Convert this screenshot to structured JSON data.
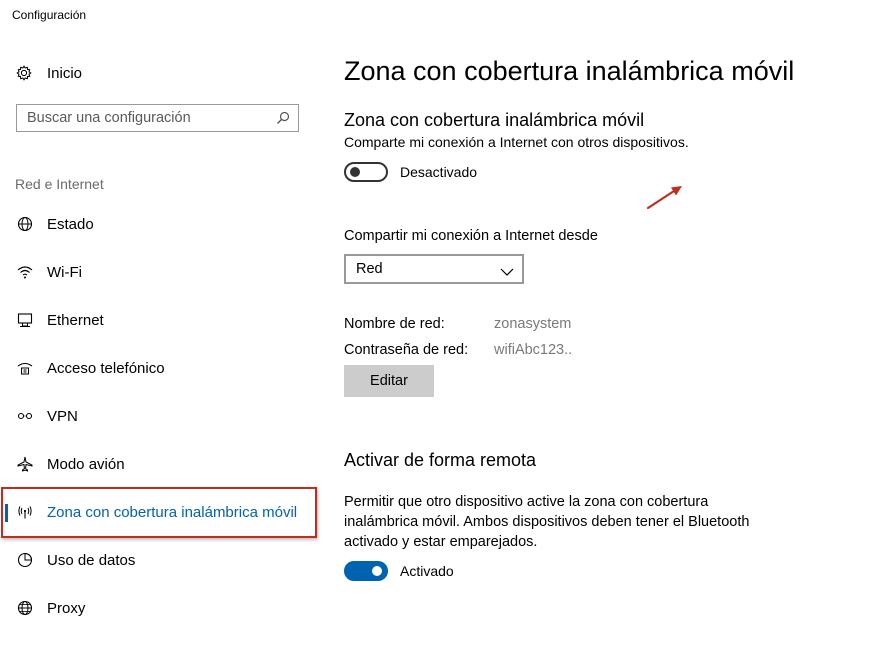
{
  "window": {
    "title": "Configuración"
  },
  "sidebar": {
    "home_label": "Inicio",
    "search_placeholder": "Buscar una configuración",
    "section_label": "Red e Internet",
    "items": [
      {
        "label": "Estado",
        "icon": "globe-network-icon"
      },
      {
        "label": "Wi-Fi",
        "icon": "wifi-icon"
      },
      {
        "label": "Ethernet",
        "icon": "ethernet-icon"
      },
      {
        "label": "Acceso telefónico",
        "icon": "dialup-icon"
      },
      {
        "label": "VPN",
        "icon": "vpn-icon"
      },
      {
        "label": "Modo avión",
        "icon": "airplane-icon"
      },
      {
        "label": "Zona con cobertura inalámbrica móvil",
        "icon": "hotspot-icon",
        "active": true
      },
      {
        "label": "Uso de datos",
        "icon": "data-usage-icon"
      },
      {
        "label": "Proxy",
        "icon": "globe-icon"
      }
    ]
  },
  "main": {
    "title": "Zona con cobertura inalámbrica móvil",
    "hotspot": {
      "heading": "Zona con cobertura inalámbrica móvil",
      "description": "Comparte mi conexión a Internet con otros dispositivos.",
      "toggle_state": "off",
      "toggle_label": "Desactivado"
    },
    "share_from": {
      "label": "Compartir mi conexión a Internet desde",
      "selected": "Red"
    },
    "network": {
      "name_label": "Nombre de red:",
      "name_value": "zonasystem",
      "password_label": "Contraseña de red:",
      "password_value": "wifiAbc123..",
      "edit_label": "Editar"
    },
    "remote": {
      "heading": "Activar de forma remota",
      "description": "Permitir que otro dispositivo active la zona con cobertura inalámbrica móvil. Ambos dispositivos deben tener el Bluetooth activado y estar emparejados.",
      "toggle_state": "on",
      "toggle_label": "Activado"
    }
  },
  "colors": {
    "accent": "#0063b1",
    "annotation": "#c42b1c"
  }
}
